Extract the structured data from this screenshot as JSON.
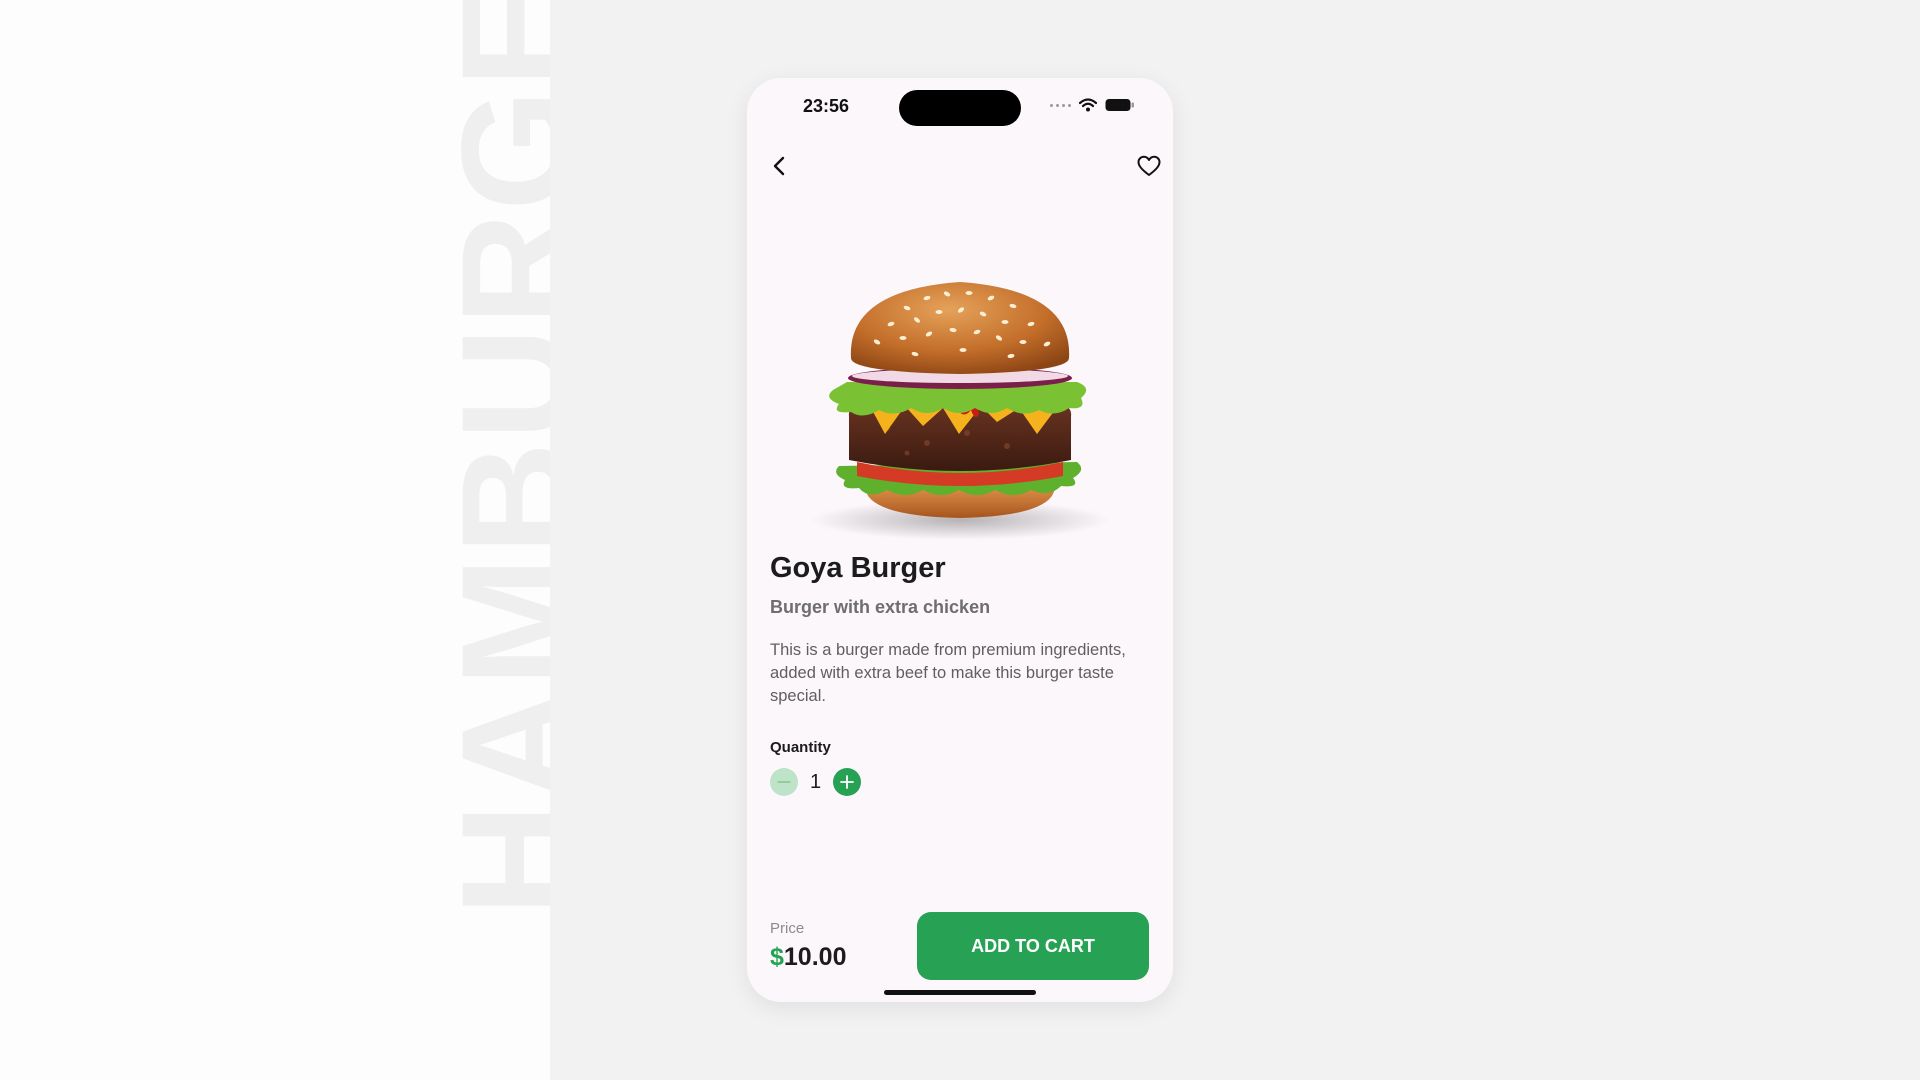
{
  "background_word": "HAMBURGER",
  "status_bar": {
    "time": "23:56"
  },
  "icons": {
    "back": "chevron-left-icon",
    "favorite": "heart-icon",
    "wifi": "wifi-icon",
    "battery": "battery-icon",
    "minus": "minus-icon",
    "plus": "plus-icon"
  },
  "product": {
    "name": "Goya Burger",
    "subtitle": "Burger with extra chicken",
    "description": "This is a burger made from premium ingredients, added with extra beef to make this burger taste special.",
    "quantity_label": "Quantity",
    "quantity": "1",
    "price_label": "Price",
    "currency": "$",
    "price": "10.00"
  },
  "actions": {
    "add_to_cart": "ADD TO CART"
  },
  "colors": {
    "accent": "#27a254",
    "accent_light": "#bfe3c8",
    "phone_bg": "#fcf7fb"
  }
}
